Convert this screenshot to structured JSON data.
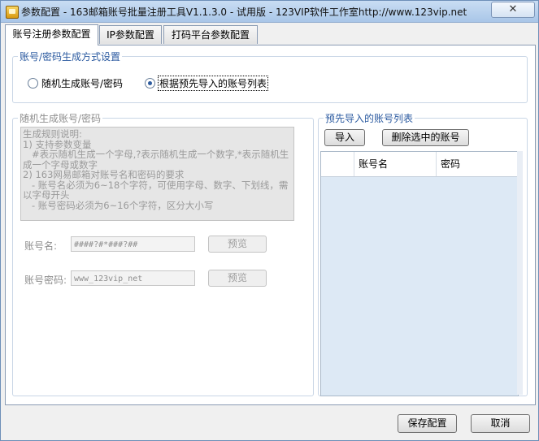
{
  "window": {
    "title": "参数配置 - 163邮箱账号批量注册工具V1.1.3.0 - 试用版 - 123VIP软件工作室http://www.123vip.net",
    "close_glyph": "✕"
  },
  "tabs": [
    {
      "label": "账号注册参数配置",
      "active": true
    },
    {
      "label": "IP参数配置",
      "active": false
    },
    {
      "label": "打码平台参数配置",
      "active": false
    }
  ],
  "gen_mode": {
    "legend": "账号/密码生成方式设置",
    "options": [
      {
        "label": "随机生成账号/密码",
        "selected": false
      },
      {
        "label": "根据预先导入的账号列表",
        "selected": true
      }
    ]
  },
  "random_gen": {
    "legend": "随机生成账号/密码",
    "rules": "生成规则说明:\n1) 支持参数变量\n   #表示随机生成一个字母,?表示随机生成一个数字,*表示随机生成一个字母或数字\n2) 163网易邮箱对账号名和密码的要求\n   - 账号名必须为6~18个字符，可使用字母、数字、下划线，需以字母开头\n   - 账号密码必须为6~16个字符，区分大小写",
    "account_label": "账号名:",
    "account_value": "####?#*###?##",
    "password_label": "账号密码:",
    "password_value": "www_123vip_net",
    "preview_label": "预览"
  },
  "import_list": {
    "legend": "预先导入的账号列表",
    "import_button": "导入",
    "delete_button": "删除选中的账号",
    "columns": [
      "",
      "账号名",
      "密码"
    ],
    "rows": []
  },
  "footer": {
    "save_label": "保存配置",
    "cancel_label": "取消"
  }
}
